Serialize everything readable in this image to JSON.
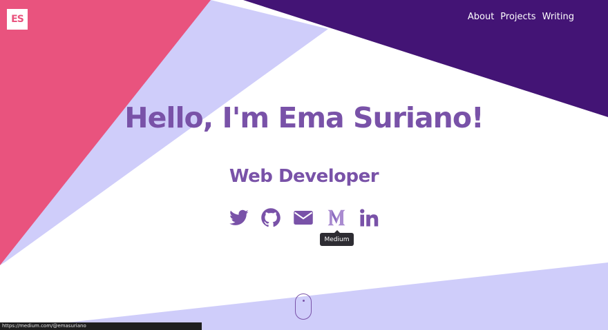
{
  "brand": {
    "logo_text": "ES"
  },
  "nav": {
    "items": [
      {
        "label": "About"
      },
      {
        "label": "Projects"
      },
      {
        "label": "Writing"
      }
    ]
  },
  "hero": {
    "title": "Hello, I'm Ema Suriano!",
    "subtitle": "Web Developer"
  },
  "social": {
    "links": [
      {
        "name": "twitter-icon"
      },
      {
        "name": "github-icon"
      },
      {
        "name": "email-icon"
      },
      {
        "name": "medium-icon"
      },
      {
        "name": "linkedin-icon"
      }
    ],
    "tooltip": "Medium"
  },
  "status_bar": {
    "url": "https://medium.com/@emasuriano"
  },
  "colors": {
    "pink": "#e9537e",
    "lavender": "#cfcdfa",
    "deep_purple": "#431475",
    "accent_purple": "#7952a8",
    "background": "#ffffff"
  }
}
